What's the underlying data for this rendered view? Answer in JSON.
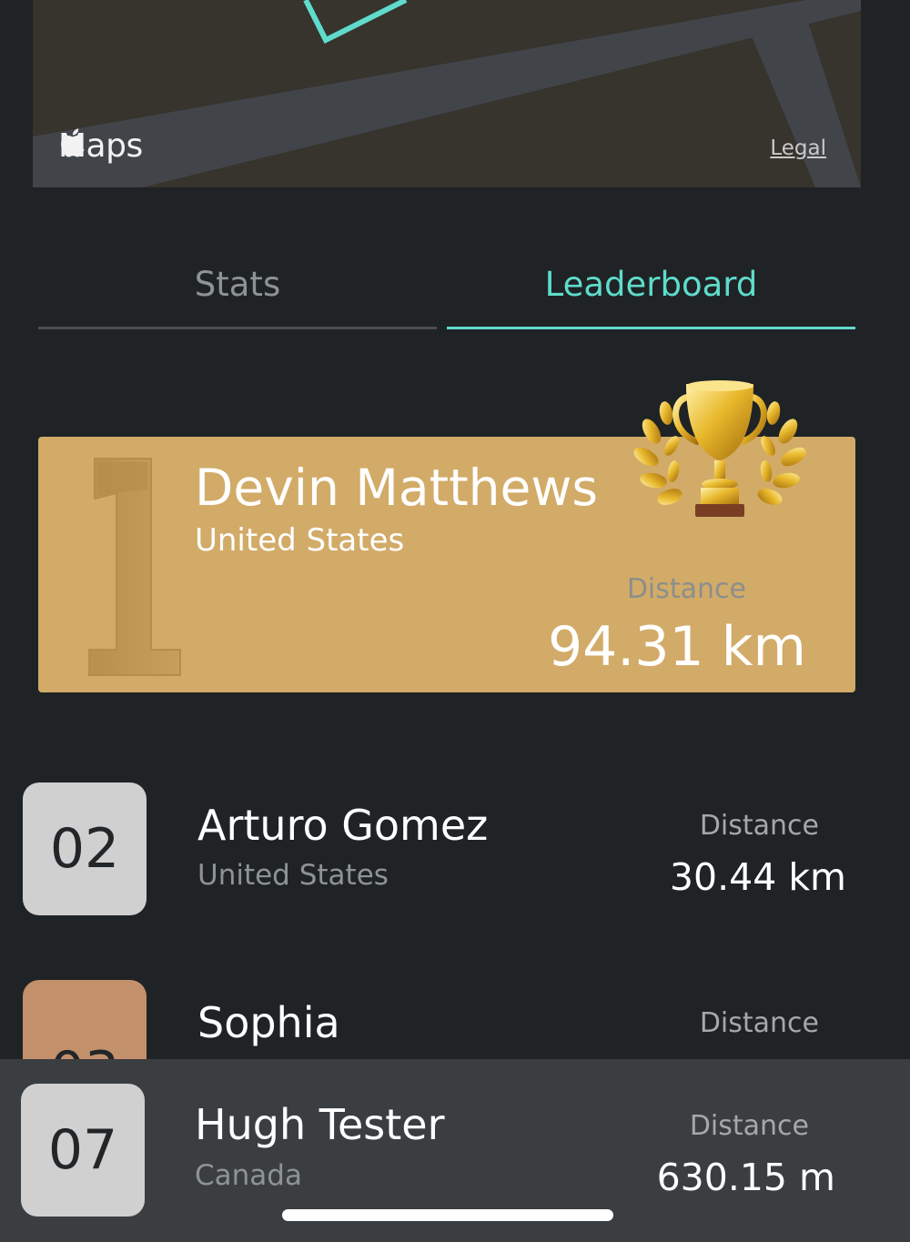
{
  "map": {
    "provider_label": "Maps",
    "legal_label": "Legal",
    "colors": {
      "land": "#37332d",
      "road": "#41454a",
      "route": "#5fdccb"
    }
  },
  "tabs": [
    {
      "label": "Stats",
      "selected": false
    },
    {
      "label": "Leaderboard",
      "selected": true
    }
  ],
  "leaderboard": {
    "first": {
      "rank": "1",
      "name": "Devin Matthews",
      "country": "United States",
      "distance_label": "Distance",
      "distance": "94.31 km",
      "icon": "trophy-icon"
    },
    "rows": [
      {
        "rank": "02",
        "name": "Arturo Gomez",
        "country": "United States",
        "distance_label": "Distance",
        "distance": "30.44 km"
      },
      {
        "rank": "03",
        "name": "Sophia",
        "country": "",
        "distance_label": "Distance",
        "distance": ""
      }
    ],
    "current_user": {
      "rank": "07",
      "name": "Hugh Tester",
      "country": "Canada",
      "distance_label": "Distance",
      "distance": "630.15 m"
    }
  },
  "colors": {
    "accent": "#5fdccb",
    "background": "#1f2325",
    "gold": "#d2ab68",
    "silver": "#d0d0d0",
    "bronze": "#c3906c"
  }
}
